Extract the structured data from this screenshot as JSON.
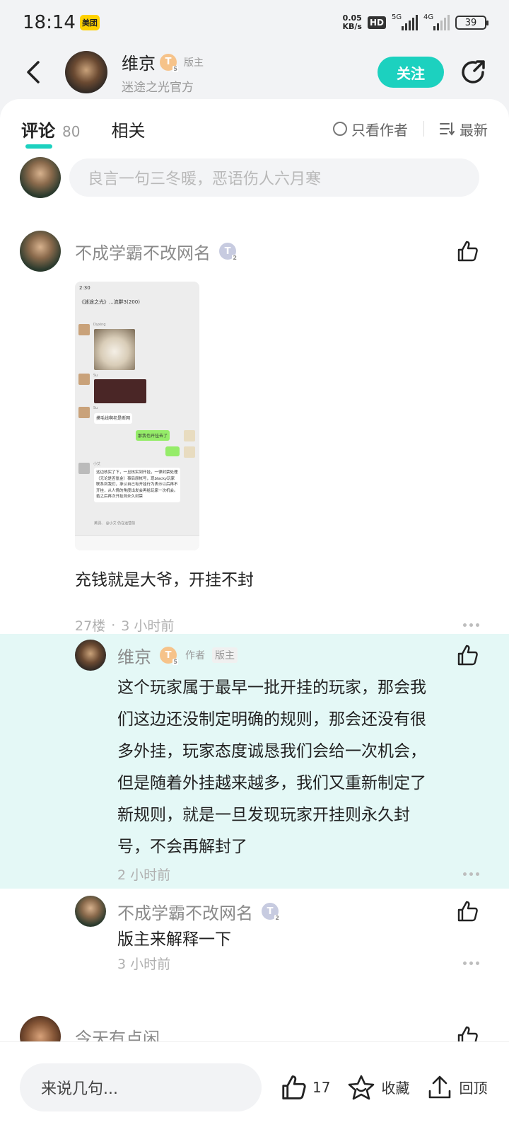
{
  "status_bar": {
    "time": "18:14",
    "app_badge": "美团",
    "speed_value": "0.05",
    "speed_unit": "KB/s",
    "hd": "HD",
    "net1": "5G",
    "net2": "4G",
    "battery": "39"
  },
  "header": {
    "name": "维京",
    "level": "T",
    "level_sub": "5",
    "role": "版主",
    "subtitle": "迷途之光官方",
    "follow_label": "关注"
  },
  "tabs": {
    "comments_label": "评论",
    "comments_count": "80",
    "related_label": "相关",
    "author_only_label": "只看作者",
    "sort_label": "最新"
  },
  "input_placeholder": "良言一句三冬暖，恶语伤人六月寒",
  "comment": {
    "author": "不成学霸不改网名",
    "level": "T",
    "level_sub": "2",
    "text": "充钱就是大爷，开挂不封",
    "floor": "27楼",
    "time": "3 小时前",
    "screenshot": {
      "status_time": "2:30",
      "title": "《迷途之光》...流群3(200)",
      "user1": "Dyxing",
      "user2": "Su",
      "user3": "Su",
      "msg1": "摸毛线啊老是断网",
      "msg2": "那我也开挂去了",
      "notice_user": "小艾",
      "notice": "这边核实了下，一旦核实到开挂，一律封禁处理（无论是否氪金）事后原帐号，现blacky玩家联系到我们，承认自己有开挂行为表示以后再不开挂，从人情的角度出发会再给玩家一次机会。若之后再次开挂则永久封禁",
      "quote": "英羽、 @小艾 仍在运营前"
    }
  },
  "replies": [
    {
      "author": "维京",
      "level": "T",
      "level_sub": "5",
      "tag1": "作者",
      "tag2": "版主",
      "lines": [
        "这个玩家属于最早一批开挂的玩家，那会我",
        "们这边还没制定明确的规则，那会还没有很",
        "多外挂，玩家态度诚恳我们会给一次机会，",
        "但是随着外挂越来越多，我们又重新制定了",
        "新规则，就是一旦发现玩家开挂则永久封",
        "号，不会再解封了"
      ],
      "time": "2 小时前"
    },
    {
      "author": "不成学霸不改网名",
      "level": "T",
      "level_sub": "2",
      "text": "版主来解释一下",
      "time": "3 小时前"
    }
  ],
  "next_comment": {
    "author": "今天有点闲"
  },
  "bottom_bar": {
    "input_label": "来说几句...",
    "like_count": "17",
    "fav_label": "收藏",
    "top_label": "回顶"
  },
  "colors": {
    "accent": "#1cd1bf",
    "highlight_bg": "#e4f8f6"
  }
}
